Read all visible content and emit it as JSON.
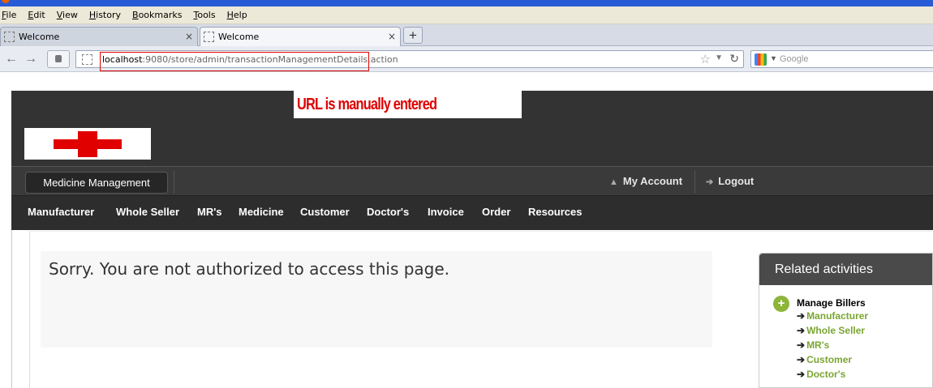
{
  "browser": {
    "menu": [
      "File",
      "Edit",
      "View",
      "History",
      "Bookmarks",
      "Tools",
      "Help"
    ],
    "tabs": [
      {
        "title": "Welcome",
        "active": false
      },
      {
        "title": "Welcome",
        "active": true
      }
    ],
    "url_host": "localhost",
    "url_path": ":9080/store/admin/transactionManagementDetails.action",
    "search_placeholder": "Google",
    "new_tab_label": "+",
    "close_label": "×"
  },
  "annotation": {
    "text": "URL is manually entered",
    "color": "#e00000"
  },
  "header": {
    "primary_button": "Medicine Management",
    "my_account": "My Account",
    "logout": "Logout"
  },
  "nav": [
    "Manufacturer",
    "Whole Seller",
    "MR's",
    "Medicine",
    "Customer",
    "Doctor's",
    "Invoice",
    "Order",
    "Resources"
  ],
  "main": {
    "error_message": "Sorry. You are not authorized to access this page."
  },
  "sidebar": {
    "title": "Related activities",
    "group_title": "Manage Billers",
    "links": [
      "Manufacturer",
      "Whole Seller",
      "MR's",
      "Customer",
      "Doctor's"
    ]
  },
  "colors": {
    "accent_green": "#7aa532",
    "header_dark": "#333333",
    "logo_red": "#e00000"
  }
}
